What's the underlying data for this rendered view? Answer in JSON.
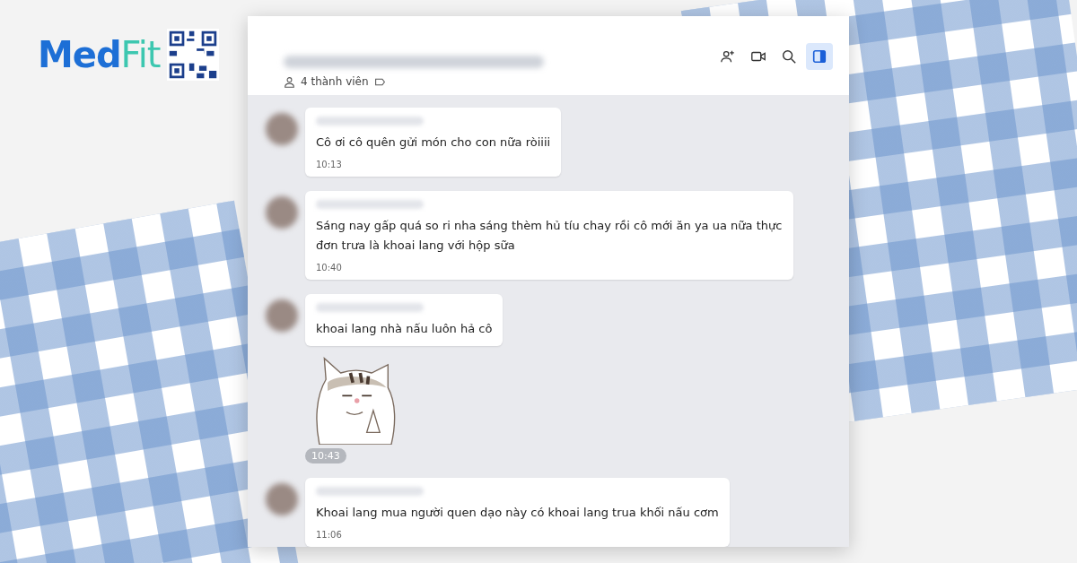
{
  "logo": {
    "part_1": "Med",
    "part_2": "Fit"
  },
  "chat": {
    "member_count": "4 thành viên",
    "header_actions": [
      {
        "kind": "add-member",
        "selected": false
      },
      {
        "kind": "video",
        "selected": false
      },
      {
        "kind": "search",
        "selected": false
      },
      {
        "kind": "panel",
        "selected": true
      }
    ],
    "messages": [
      {
        "kind": "text",
        "text": "Cô ơi cô quên gửi món cho con nữa ròiiii",
        "time": "10:13"
      },
      {
        "kind": "text",
        "text": "Sáng nay gấp quá so ri nha sáng thèm hủ tíu chay rồi cô mới ăn ya ua  nữa thực đơn trưa là  khoai lang với hộp sữa",
        "time": "10:40"
      },
      {
        "kind": "text",
        "text": "khoai lang nhà nấu luôn hả cô"
      },
      {
        "kind": "sticker",
        "time": "10:43"
      },
      {
        "kind": "text",
        "text": "Khoai lang mua người quen dạo này có khoai lang trua khối nấu cơm",
        "time": "11:06"
      }
    ]
  }
}
